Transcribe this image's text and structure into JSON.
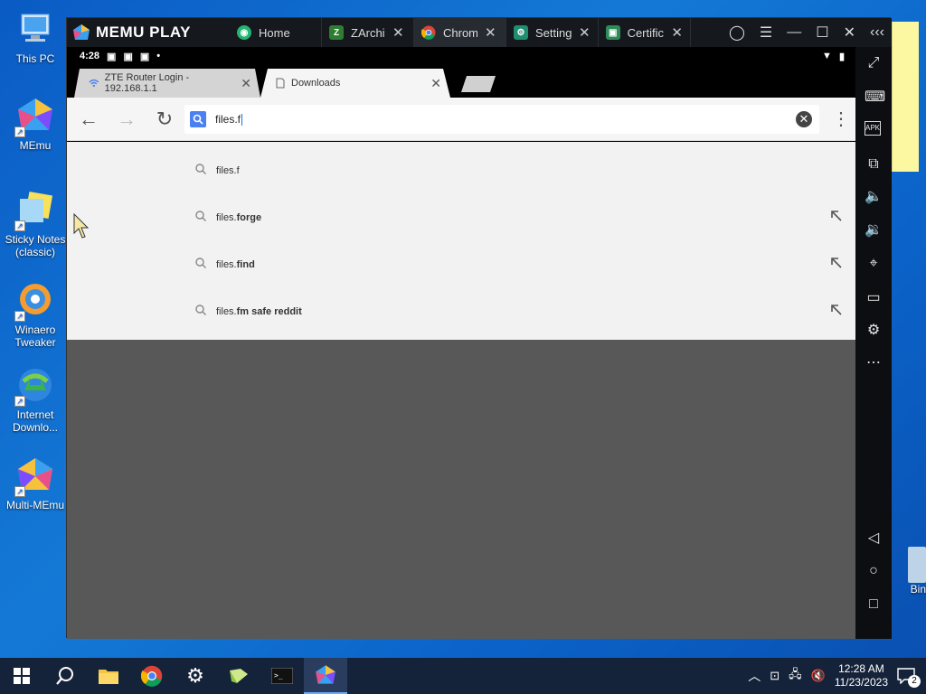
{
  "desktop": {
    "icons": [
      {
        "label": "This PC"
      },
      {
        "label": "MEmu"
      },
      {
        "label": "Sticky Notes (classic)"
      },
      {
        "label": "Winaero Tweaker"
      },
      {
        "label": "Internet Downlo..."
      },
      {
        "label": "Multi-MEmu"
      }
    ],
    "recycle_bin_label": "Bin"
  },
  "memu": {
    "brand": "MEMU PLAY",
    "tabs": [
      {
        "label": "Home",
        "color": "#22b573"
      },
      {
        "label": "ZArchi",
        "color": "#2e7d32",
        "glyph": "Z"
      },
      {
        "label": "Chrom",
        "color": "#ffffff"
      },
      {
        "label": "Setting",
        "color": "#1e8e6e"
      },
      {
        "label": "Certific",
        "color": "#2e8b57"
      }
    ]
  },
  "android": {
    "status": {
      "time": "4:28"
    },
    "chrome": {
      "tabs": [
        {
          "title": "ZTE Router Login - 192.168.1.1"
        },
        {
          "title": "Downloads"
        }
      ],
      "omnibox_text": "files.f",
      "suggestions": [
        {
          "prefix": "files.f",
          "bold": ""
        },
        {
          "prefix": "files.",
          "bold": "forge"
        },
        {
          "prefix": "files.",
          "bold": "find"
        },
        {
          "prefix": "files.",
          "bold": "fm safe reddit"
        }
      ]
    }
  },
  "taskbar": {
    "time": "12:28 AM",
    "date": "11/23/2023",
    "notification_count": "2"
  },
  "colors": {
    "desktop_blue": "#0a5bc4",
    "chrome_page_gray": "#585858",
    "memu_titlebar": "#15181d"
  }
}
